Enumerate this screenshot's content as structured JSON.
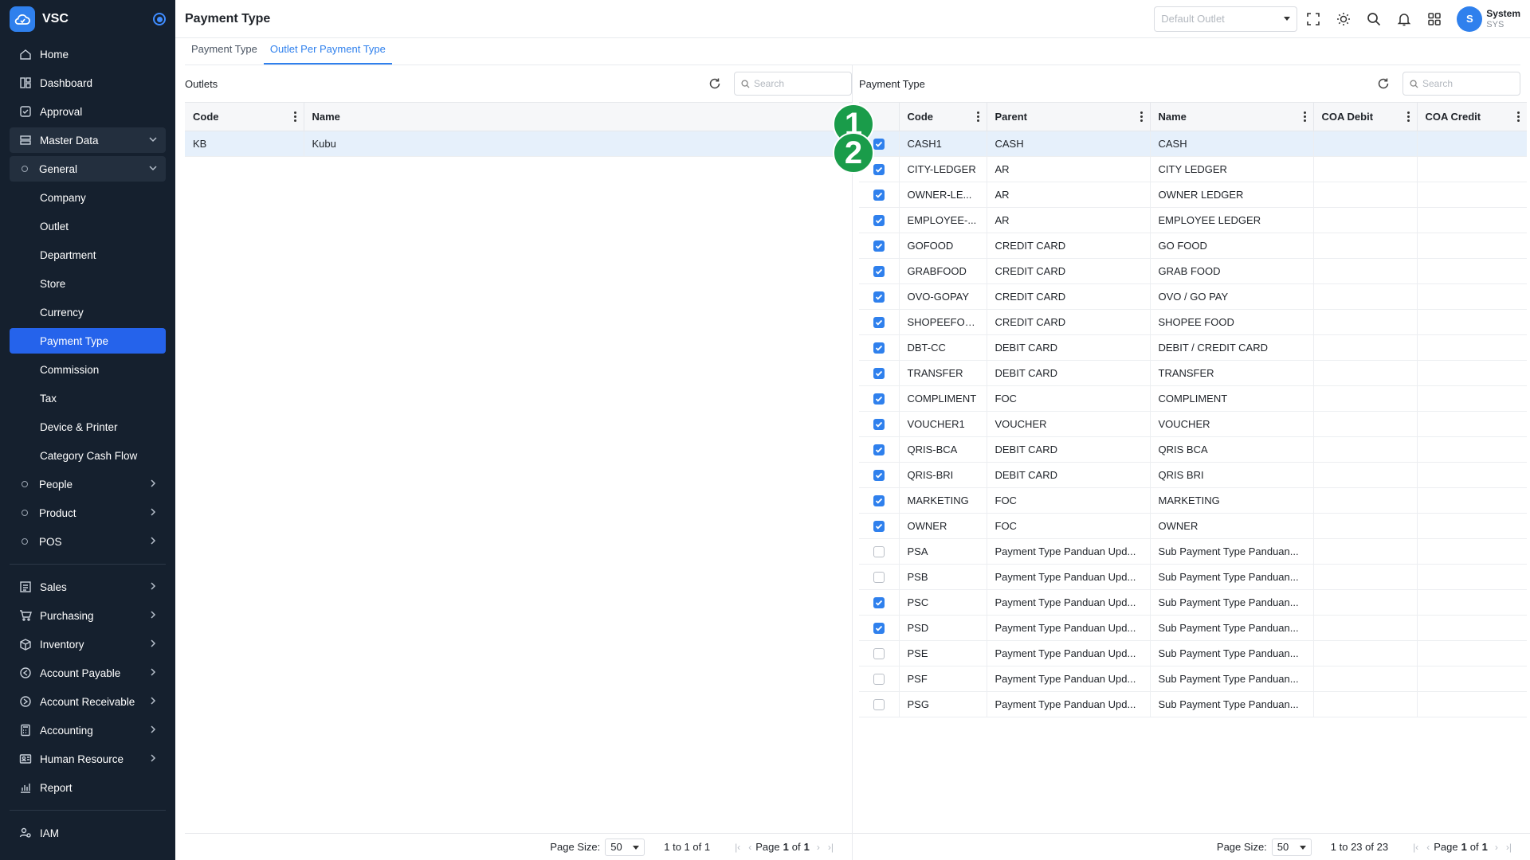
{
  "app": {
    "name": "VSC",
    "page_title": "Payment Type"
  },
  "sidebar": {
    "top_items": [
      {
        "label": "Home",
        "icon": "home-icon"
      },
      {
        "label": "Dashboard",
        "icon": "dashboard-icon"
      },
      {
        "label": "Approval",
        "icon": "approval-icon"
      },
      {
        "label": "Master Data",
        "icon": "master-data-icon"
      }
    ],
    "general_label": "General",
    "general_items": [
      "Company",
      "Outlet",
      "Department",
      "Store",
      "Currency",
      "Payment Type",
      "Commission",
      "Tax",
      "Device & Printer",
      "Category Cash Flow"
    ],
    "other_groups": [
      "People",
      "Product",
      "POS"
    ],
    "bottom_items": [
      {
        "label": "Sales",
        "icon": "sales-icon"
      },
      {
        "label": "Purchasing",
        "icon": "cart-icon"
      },
      {
        "label": "Inventory",
        "icon": "box-icon"
      },
      {
        "label": "Account Payable",
        "icon": "payable-icon"
      },
      {
        "label": "Account Receivable",
        "icon": "receivable-icon"
      },
      {
        "label": "Accounting",
        "icon": "calculator-icon"
      },
      {
        "label": "Human Resource",
        "icon": "person-card-icon"
      },
      {
        "label": "Report",
        "icon": "chart-icon"
      }
    ],
    "iam_label": "IAM"
  },
  "header": {
    "outlet_placeholder": "Default Outlet",
    "user_initial": "S",
    "user_name": "System",
    "user_sub": "SYS"
  },
  "tabs": [
    "Payment Type",
    "Outlet Per Payment Type"
  ],
  "outlets": {
    "title": "Outlets",
    "search_placeholder": "Search",
    "columns": [
      "Code",
      "Name"
    ],
    "rows": [
      {
        "code": "KB",
        "name": "Kubu"
      }
    ],
    "page_size_label": "Page Size:",
    "page_size": "50",
    "range": "1 to 1 of 1",
    "page_word": "Page",
    "page_current": "1",
    "page_of": "of",
    "page_total": "1"
  },
  "payment_types": {
    "title": "Payment Type",
    "search_placeholder": "Search",
    "columns": [
      "Code",
      "Parent",
      "Name",
      "COA Debit",
      "COA Credit"
    ],
    "rows": [
      {
        "checked": true,
        "code": "CASH1",
        "parent": "CASH",
        "name": "CASH"
      },
      {
        "checked": true,
        "code": "CITY-LEDGER",
        "parent": "AR",
        "name": "CITY LEDGER"
      },
      {
        "checked": true,
        "code": "OWNER-LE...",
        "parent": "AR",
        "name": "OWNER LEDGER"
      },
      {
        "checked": true,
        "code": "EMPLOYEE-...",
        "parent": "AR",
        "name": "EMPLOYEE LEDGER"
      },
      {
        "checked": true,
        "code": "GOFOOD",
        "parent": "CREDIT CARD",
        "name": "GO FOOD"
      },
      {
        "checked": true,
        "code": "GRABFOOD",
        "parent": "CREDIT CARD",
        "name": "GRAB FOOD"
      },
      {
        "checked": true,
        "code": "OVO-GOPAY",
        "parent": "CREDIT CARD",
        "name": "OVO / GO PAY"
      },
      {
        "checked": true,
        "code": "SHOPEEFOOD",
        "parent": "CREDIT CARD",
        "name": "SHOPEE FOOD"
      },
      {
        "checked": true,
        "code": "DBT-CC",
        "parent": "DEBIT CARD",
        "name": "DEBIT / CREDIT CARD"
      },
      {
        "checked": true,
        "code": "TRANSFER",
        "parent": "DEBIT CARD",
        "name": "TRANSFER"
      },
      {
        "checked": true,
        "code": "COMPLIMENT",
        "parent": "FOC",
        "name": "COMPLIMENT"
      },
      {
        "checked": true,
        "code": "VOUCHER1",
        "parent": "VOUCHER",
        "name": "VOUCHER"
      },
      {
        "checked": true,
        "code": "QRIS-BCA",
        "parent": "DEBIT CARD",
        "name": "QRIS BCA"
      },
      {
        "checked": true,
        "code": "QRIS-BRI",
        "parent": "DEBIT CARD",
        "name": "QRIS BRI"
      },
      {
        "checked": true,
        "code": "MARKETING",
        "parent": "FOC",
        "name": "MARKETING"
      },
      {
        "checked": true,
        "code": "OWNER",
        "parent": "FOC",
        "name": "OWNER"
      },
      {
        "checked": false,
        "code": "PSA",
        "parent": "Payment Type Panduan Upd...",
        "name": "Sub Payment Type Panduan..."
      },
      {
        "checked": false,
        "code": "PSB",
        "parent": "Payment Type Panduan Upd...",
        "name": "Sub Payment Type Panduan..."
      },
      {
        "checked": true,
        "code": "PSC",
        "parent": "Payment Type Panduan Upd...",
        "name": "Sub Payment Type Panduan..."
      },
      {
        "checked": true,
        "code": "PSD",
        "parent": "Payment Type Panduan Upd...",
        "name": "Sub Payment Type Panduan..."
      },
      {
        "checked": false,
        "code": "PSE",
        "parent": "Payment Type Panduan Upd...",
        "name": "Sub Payment Type Panduan..."
      },
      {
        "checked": false,
        "code": "PSF",
        "parent": "Payment Type Panduan Upd...",
        "name": "Sub Payment Type Panduan..."
      },
      {
        "checked": false,
        "code": "PSG",
        "parent": "Payment Type Panduan Upd...",
        "name": "Sub Payment Type Panduan..."
      }
    ],
    "page_size_label": "Page Size:",
    "page_size": "50",
    "range": "1 to 23 of 23",
    "page_word": "Page",
    "page_current": "1",
    "page_of": "of",
    "page_total": "1"
  },
  "markers": [
    "1",
    "2"
  ],
  "colors": {
    "sidebar_bg": "#15202e",
    "accent": "#2f80ed",
    "active_nav": "#2563eb",
    "marker": "#1a9c4a",
    "selected_row": "#e6f0fb"
  }
}
